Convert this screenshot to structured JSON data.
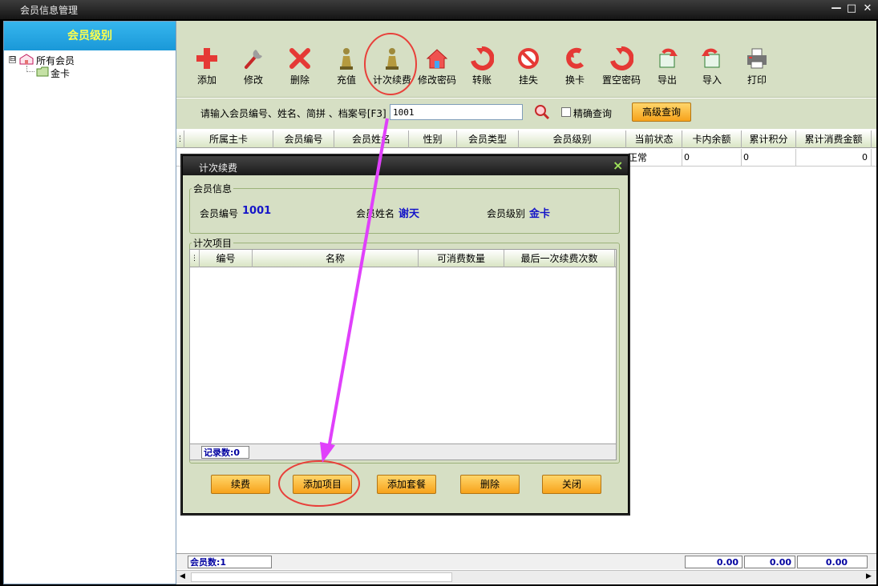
{
  "window": {
    "title": "会员信息管理",
    "controls": [
      "—",
      "□",
      "✕"
    ]
  },
  "left_panel": {
    "header": "会员级别",
    "tree": [
      {
        "label": "所有会员",
        "expander": "⊟"
      },
      {
        "label": "金卡"
      }
    ]
  },
  "toolbar": {
    "buttons": [
      {
        "label": "添加",
        "icon": "add-icon"
      },
      {
        "label": "修改",
        "icon": "edit-icon"
      },
      {
        "label": "删除",
        "icon": "delete-icon"
      },
      {
        "label": "充值",
        "icon": "recharge-icon"
      },
      {
        "label": "计次续费",
        "icon": "count-renew-icon"
      },
      {
        "label": "修改密码",
        "icon": "password-icon"
      },
      {
        "label": "转账",
        "icon": "transfer-icon"
      },
      {
        "label": "挂失",
        "icon": "report-loss-icon"
      },
      {
        "label": "换卡",
        "icon": "change-card-icon"
      },
      {
        "label": "置空密码",
        "icon": "clear-password-icon"
      },
      {
        "label": "导出",
        "icon": "export-icon"
      },
      {
        "label": "导入",
        "icon": "import-icon"
      },
      {
        "label": "打印",
        "icon": "print-icon"
      }
    ]
  },
  "search": {
    "label": "请输入会员编号、姓名、简拼 、档案号[F3]",
    "value": "1001",
    "exact_label": "精确查询",
    "advanced_label": "高级查询"
  },
  "main_table": {
    "columns": [
      "所属主卡",
      "会员编号",
      "会员姓名",
      "性别",
      "会员类型",
      "会员级别",
      "当前状态",
      "卡内余额",
      "累计积分",
      "累计消费金额"
    ],
    "rows": [
      {
        "status": "正常",
        "balance": "0",
        "points": "0",
        "spent": "0"
      }
    ]
  },
  "main_footer": {
    "count_label": "会员数:1",
    "totals": [
      "0.00",
      "0.00",
      "0.00"
    ]
  },
  "dialog": {
    "title": "计次续费",
    "close": "×",
    "member_info": {
      "legend": "会员信息",
      "id_label": "会员编号",
      "id_value": "1001",
      "name_label": "会员姓名",
      "name_value": "谢天",
      "level_label": "会员级别",
      "level_value": "金卡"
    },
    "items": {
      "legend": "计次项目",
      "columns": [
        "编号",
        "名称",
        "可消费数量",
        "最后一次续费次数"
      ],
      "record_count": "记录数:0"
    },
    "buttons": [
      "续费",
      "添加项目",
      "添加套餐",
      "删除",
      "关闭"
    ]
  },
  "colors": {
    "panel_bg": "#d6dfc4",
    "accent_blue": "#1a98d8",
    "highlight_yellow": "#ffff4c",
    "annotation": "#e8403a",
    "arrow": "#e040fb"
  }
}
